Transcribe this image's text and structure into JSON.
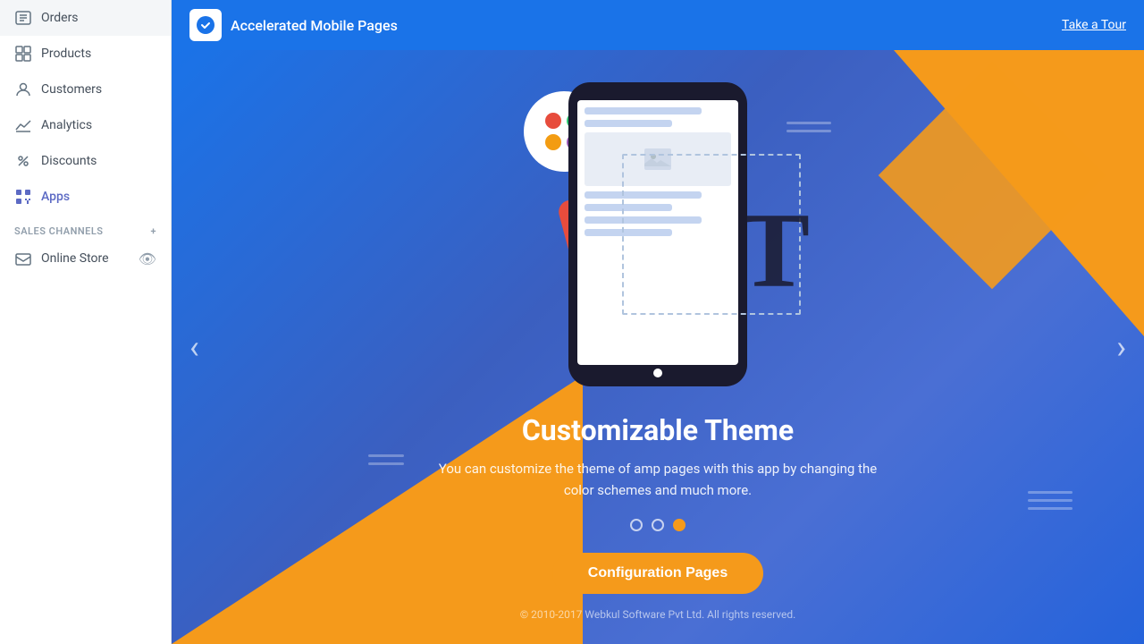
{
  "sidebar": {
    "items": [
      {
        "id": "orders",
        "label": "Orders",
        "active": false
      },
      {
        "id": "products",
        "label": "Products",
        "active": false
      },
      {
        "id": "customers",
        "label": "Customers",
        "active": false
      },
      {
        "id": "analytics",
        "label": "Analytics",
        "active": false
      },
      {
        "id": "discounts",
        "label": "Discounts",
        "active": false
      },
      {
        "id": "apps",
        "label": "Apps",
        "active": true
      }
    ],
    "sales_channels_label": "SALES CHANNELS",
    "online_store_label": "Online Store"
  },
  "app_header": {
    "title": "Accelerated Mobile Pages",
    "take_tour_label": "Take a Tour"
  },
  "carousel": {
    "title": "Customizable Theme",
    "description": "You can customize the theme of amp pages with this app by changing the color schemes and much more.",
    "config_button_label": "Configuration Pages",
    "footer_text": "© 2010-2017 Webkul Software Pvt Ltd. All rights reserved.",
    "dots": [
      {
        "id": 0,
        "active": false
      },
      {
        "id": 1,
        "active": false
      },
      {
        "id": 2,
        "active": true
      }
    ],
    "colors": {
      "accent": "#f59a1b",
      "bg_start": "#1a73e8",
      "bg_end": "#2563db"
    },
    "palette_colors": [
      "#e74c3c",
      "#2ecc71",
      "#f39c12",
      "#9b59b6"
    ],
    "swatches": [
      "#e74c3c",
      "#e8827a",
      "#f0aaa6",
      "#3cb371",
      "#7fd4a0",
      "#9b59b6",
      "#c39bd3",
      "#f1c40f"
    ]
  }
}
